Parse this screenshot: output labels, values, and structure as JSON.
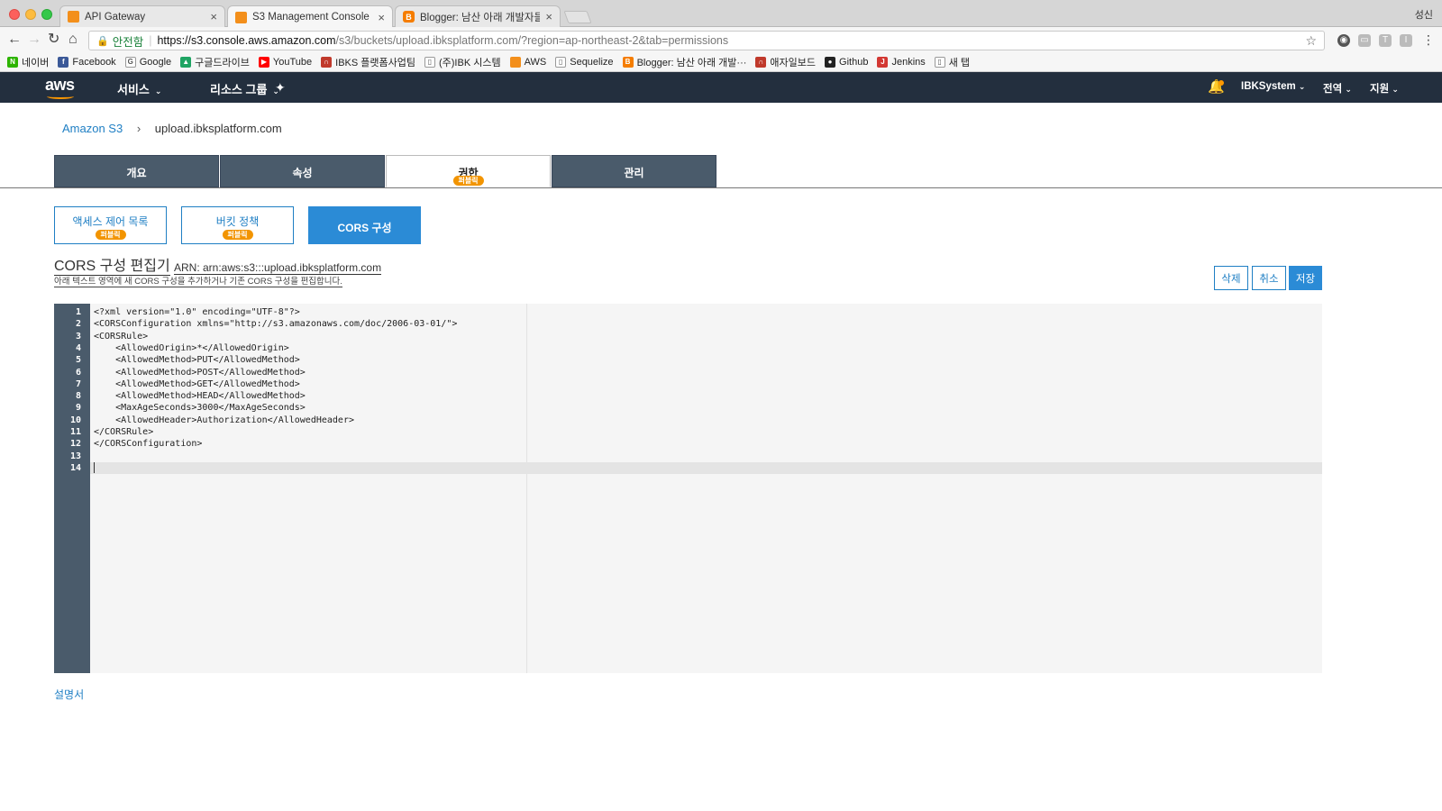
{
  "browser": {
    "tabs": [
      {
        "title": "API Gateway",
        "icon": "aws-icon"
      },
      {
        "title": "S3 Management Console",
        "icon": "aws-icon",
        "active": true
      },
      {
        "title": "Blogger: 남산 아래 개발자들 - 게시",
        "icon": "blogger-icon"
      }
    ],
    "profile_name": "성신",
    "secure_label": "안전함",
    "url_host": "https://s3.console.aws.amazon.com",
    "url_path": "/s3/buckets/upload.ibksplatform.com/?region=ap-northeast-2&tab=permissions",
    "bookmarks": [
      {
        "label": "네이버",
        "icon": "naver-icon",
        "color": "#2db400",
        "glyph": "N"
      },
      {
        "label": "Facebook",
        "icon": "facebook-icon",
        "color": "#3b5998",
        "glyph": "f"
      },
      {
        "label": "Google",
        "icon": "google-icon",
        "color": "#ffffff",
        "glyph": "G"
      },
      {
        "label": "구글드라이브",
        "icon": "google-drive-icon",
        "color": "#1fa463",
        "glyph": "▲"
      },
      {
        "label": "YouTube",
        "icon": "youtube-icon",
        "color": "#ff0000",
        "glyph": "▶"
      },
      {
        "label": "IBKS 플랫폼사업팀",
        "icon": "bookmark-icon",
        "color": "#c0392b",
        "glyph": "∩"
      },
      {
        "label": "(주)IBK 시스템",
        "icon": "page-icon",
        "color": "#ffffff",
        "glyph": "▯"
      },
      {
        "label": "AWS",
        "icon": "aws-icon",
        "color": "#f38f1b",
        "glyph": ""
      },
      {
        "label": "Sequelize",
        "icon": "page-icon",
        "color": "#ffffff",
        "glyph": "▯"
      },
      {
        "label": "Blogger: 남산 아래 개발···",
        "icon": "blogger-icon",
        "color": "#f57d00",
        "glyph": "B"
      },
      {
        "label": "애자일보드",
        "icon": "bookmark-icon",
        "color": "#c0392b",
        "glyph": "∩"
      },
      {
        "label": "Github",
        "icon": "github-icon",
        "color": "#222222",
        "glyph": "●"
      },
      {
        "label": "Jenkins",
        "icon": "jenkins-icon",
        "color": "#d33833",
        "glyph": "J"
      },
      {
        "label": "새 탭",
        "icon": "page-icon",
        "color": "#ffffff",
        "glyph": "▯"
      }
    ]
  },
  "aws_nav": {
    "logo": "aws",
    "services": "서비스",
    "resource_groups": "리소스 그룹",
    "account": "IBKSystem",
    "region": "전역",
    "support": "지원"
  },
  "breadcrumb": {
    "root": "Amazon S3",
    "current": "upload.ibksplatform.com"
  },
  "main_tabs": [
    {
      "label": "개요"
    },
    {
      "label": "속성"
    },
    {
      "label": "권한",
      "badge": "퍼블릭",
      "active": true
    },
    {
      "label": "관리"
    }
  ],
  "sub_tabs": [
    {
      "label": "액세스 제어 목록",
      "badge": "퍼블릭"
    },
    {
      "label": "버킷 정책",
      "badge": "퍼블릭"
    },
    {
      "label": "CORS 구성",
      "active": true
    }
  ],
  "editor": {
    "title": "CORS 구성 편집기",
    "arn": "ARN: arn:aws:s3:::upload.ibksplatform.com",
    "description": "아래 텍스트 영역에 새 CORS 구성을 추가하거나 기존 CORS 구성을 편집합니다.",
    "delete_label": "삭제",
    "cancel_label": "취소",
    "save_label": "저장",
    "lines": [
      "<?xml version=\"1.0\" encoding=\"UTF-8\"?>",
      "<CORSConfiguration xmlns=\"http://s3.amazonaws.com/doc/2006-03-01/\">",
      "<CORSRule>",
      "    <AllowedOrigin>*</AllowedOrigin>",
      "    <AllowedMethod>PUT</AllowedMethod>",
      "    <AllowedMethod>POST</AllowedMethod>",
      "    <AllowedMethod>GET</AllowedMethod>",
      "    <AllowedMethod>HEAD</AllowedMethod>",
      "    <MaxAgeSeconds>3000</MaxAgeSeconds>",
      "    <AllowedHeader>Authorization</AllowedHeader>",
      "</CORSRule>",
      "</CORSConfiguration>",
      "",
      ""
    ]
  },
  "docs_link": "설명서",
  "colors": {
    "aws_nav_bg": "#232f3e",
    "tab_dark": "#4a5b6b",
    "link_blue": "#1f7fc4",
    "primary_blue": "#2b8bd6",
    "badge_orange": "#f29400"
  }
}
